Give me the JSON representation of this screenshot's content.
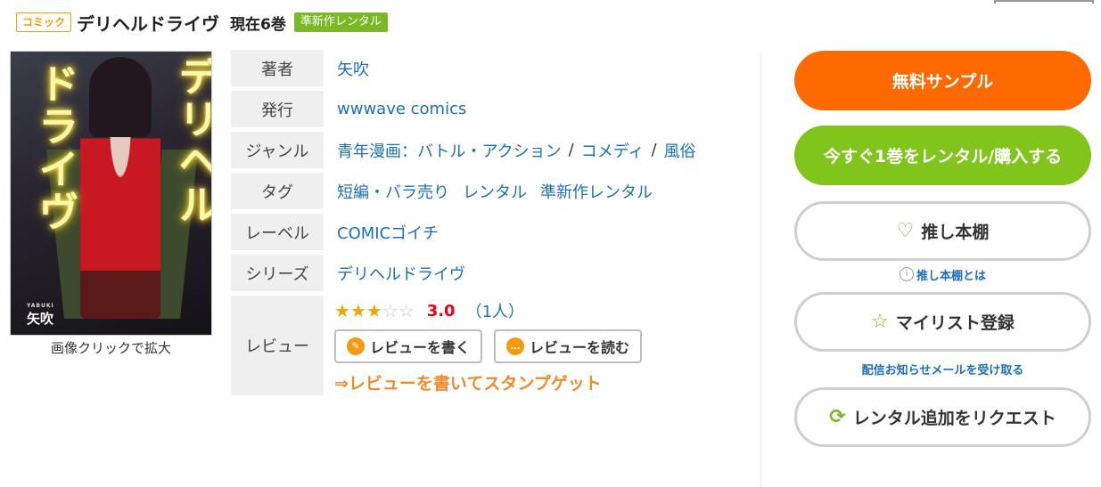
{
  "header": {
    "category_tag": "コミック",
    "title": "デリヘルドライヴ",
    "volume": "現在6巻",
    "rental_badge": "準新作レンタル"
  },
  "cover": {
    "neon_text_1": "デリヘル",
    "neon_text_2": "ドライヴ",
    "author_small": "YABUKI",
    "author_name": "矢吹",
    "caption": "画像クリックで拡大"
  },
  "info": {
    "author": {
      "label": "著者",
      "value": "矢吹"
    },
    "publisher": {
      "label": "発行",
      "value": "wwwave comics"
    },
    "genre": {
      "label": "ジャンル",
      "items": [
        "青年漫画：バトル・アクション",
        "コメディ",
        "風俗"
      ],
      "separator": "/"
    },
    "tags": {
      "label": "タグ",
      "items": [
        "短編・バラ売り",
        "レンタル",
        "準新作レンタル"
      ]
    },
    "label_row": {
      "label": "レーベル",
      "value": "COMICゴイチ"
    },
    "series": {
      "label": "シリーズ",
      "value": "デリヘルドライヴ"
    },
    "review": {
      "label": "レビュー",
      "rating": 3,
      "max_rating": 5,
      "score": "3.0",
      "count": "（1人）",
      "write_button": "レビューを書く",
      "read_button": "レビューを読む",
      "stamp_link": "⇒レビューを書いてスタンプゲット"
    }
  },
  "actions": {
    "free_sample": "無料サンプル",
    "rent_now": "今すぐ1巻をレンタル/購入する",
    "oshi_shelf": "推し本棚",
    "oshi_about": "推し本棚とは",
    "mylist": "マイリスト登録",
    "notify": "配信お知らせメールを受け取る",
    "request": "レンタル追加をリクエスト"
  },
  "colors": {
    "orange": "#ff6a00",
    "green": "#80c41c",
    "link": "#1a6fbd",
    "score": "#e8001c"
  }
}
